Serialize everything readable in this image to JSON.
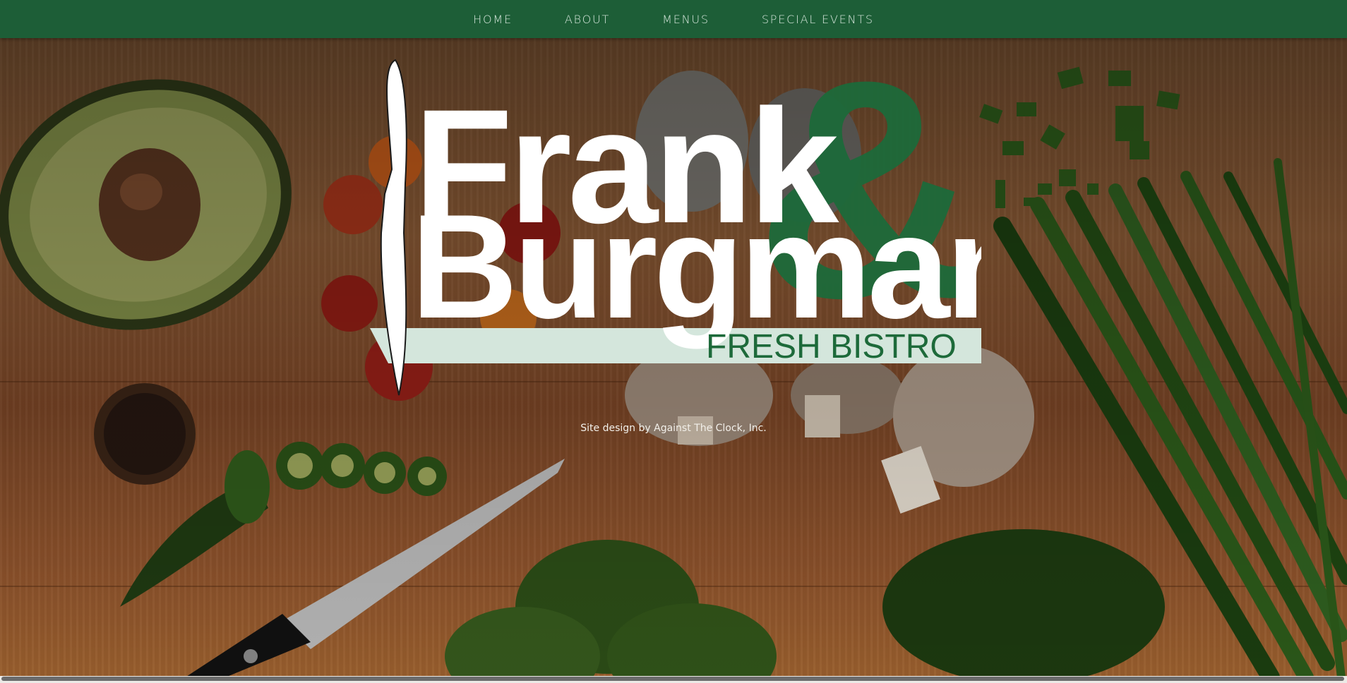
{
  "nav": {
    "items": [
      {
        "label": "HOME"
      },
      {
        "label": "ABOUT"
      },
      {
        "label": "MENUS"
      },
      {
        "label": "SPECIAL EVENTS"
      }
    ]
  },
  "logo": {
    "line1": "Frank",
    "ampersand": "&",
    "line2": "Burgman",
    "tagline": "FRESH BISTRO"
  },
  "footer": {
    "credit": "Site design by Against The Clock, Inc."
  },
  "colors": {
    "brand_green": "#1d5e37",
    "tagline_band": "#d4e6dc",
    "logo_white": "#ffffff"
  }
}
